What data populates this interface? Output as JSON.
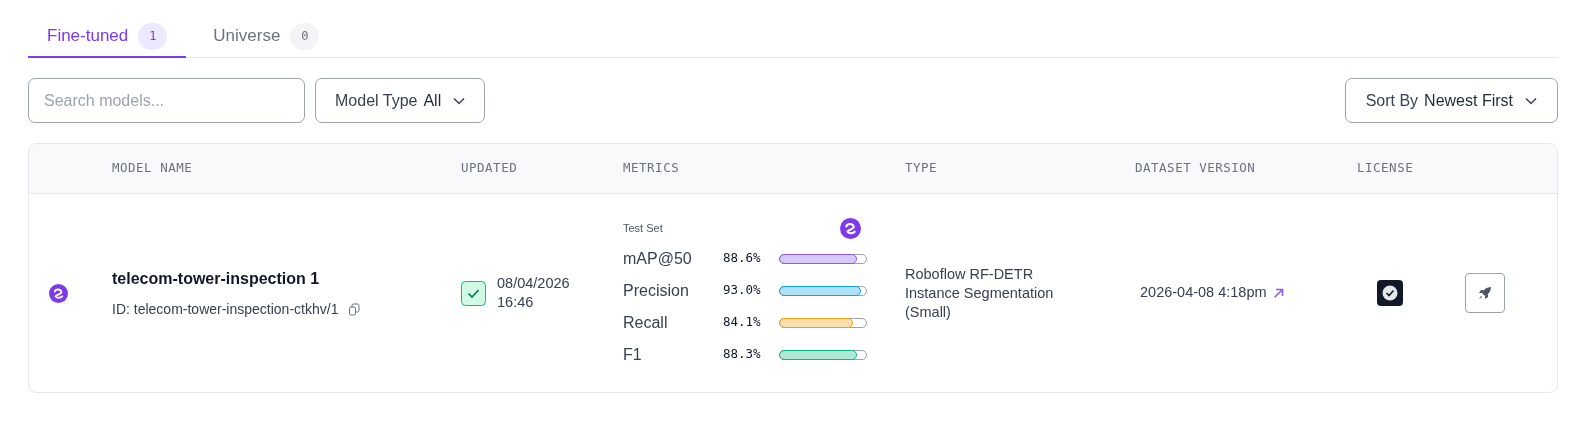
{
  "tabs": [
    {
      "label": "Fine-tuned",
      "count": "1",
      "selected": true
    },
    {
      "label": "Universe",
      "count": "0",
      "selected": false
    }
  ],
  "search": {
    "placeholder": "Search models..."
  },
  "model_type_filter": {
    "label": "Model Type",
    "value": "All"
  },
  "sort": {
    "label": "Sort By",
    "value": "Newest First"
  },
  "table": {
    "columns": [
      "",
      "MODEL NAME",
      "UPDATED",
      "METRICS",
      "TYPE",
      "DATASET VERSION",
      "LICENSE"
    ],
    "rows": [
      {
        "name": "telecom-tower-inspection 1",
        "id": "ID: telecom-tower-inspection-ctkhv/1",
        "updated_date": "08/04/2026",
        "updated_time": "16:46",
        "metrics_label": "Test Set",
        "metrics": [
          {
            "name": "mAP@50",
            "reading": "88.6%",
            "level": 0.886,
            "color": "#8b5cf6"
          },
          {
            "name": "Precision",
            "reading": "93.0%",
            "level": 0.93,
            "color": "#0ea5e9"
          },
          {
            "name": "Recall",
            "reading": "84.1%",
            "level": 0.841,
            "color": "#f59e0b"
          },
          {
            "name": "F1",
            "reading": "88.3%",
            "level": 0.883,
            "color": "#10b981"
          }
        ],
        "type": "Roboflow RF-DETR Instance Segmentation (Small)",
        "dataset_version": "2026-04-08 4:18pm"
      }
    ]
  }
}
